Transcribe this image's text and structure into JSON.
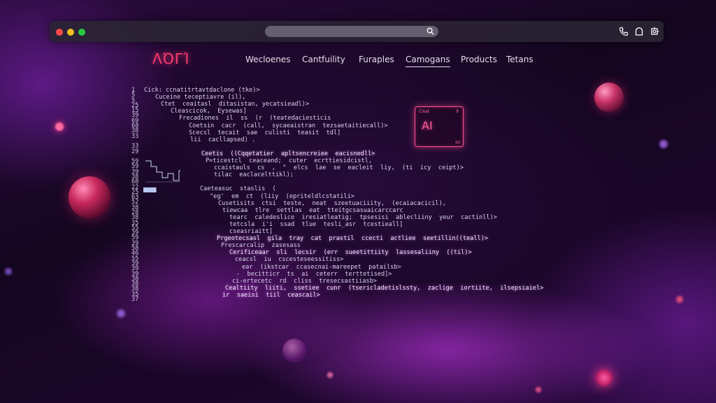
{
  "logo": "ΛΌΓΊ",
  "nav": [
    {
      "label": "Wecloenes"
    },
    {
      "label": "Cantfuility"
    },
    {
      "label": "Furaples"
    },
    {
      "label": "Camogans",
      "active": true
    },
    {
      "label": "Products"
    },
    {
      "label": "Tetans"
    }
  ],
  "ai_badge": {
    "top": "Cisat",
    "number": "9",
    "text": "AI",
    "bottom": "ez"
  },
  "mini_bars": "▆▆▆",
  "code": {
    "line_numbers": [
      "1",
      "5",
      "5",
      "25",
      "15",
      "39",
      "69",
      "68",
      "38",
      "33",
      "",
      "33",
      "29",
      "",
      "59",
      "59",
      "39",
      "38",
      "68",
      "22",
      "25",
      "63",
      "52",
      "38",
      "28",
      "38",
      "35",
      "55",
      "39",
      "59",
      "39",
      "58",
      "46",
      "55",
      "39",
      "39",
      "39",
      "38",
      "38",
      "38",
      "35",
      "37"
    ],
    "lines": [
      {
        "text": "Cick: ccnatitrtavtdaclone (tke)>",
        "indent": 18
      },
      {
        "text": "Cuceine teceptiavre (il),",
        "indent": 34
      },
      {
        "text": "Ctet  ceaitasl  ditasistan, yecatsieadl)>",
        "indent": 42
      },
      {
        "text": "Cleascicok,  Eysewas]",
        "indent": 56
      },
      {
        "text": "Frecadiones  il  ss  (r  (teatedaciesticis",
        "indent": 68
      },
      {
        "text": "Coetsin  cacr  (call,  sycaeaistran  tezsaetaitiecall)>",
        "indent": 82
      },
      {
        "text": "Scecsl  tecait  sae  culisti  teasit  tdl]",
        "indent": 82
      },
      {
        "text": "lii  cacllapsed) .",
        "indent": 84
      },
      {
        "text": "",
        "indent": 0
      },
      {
        "text": "Ceetis  ((Cqqetatier  apltsencreiee  eacisnedll>",
        "indent": 100,
        "glow": true
      },
      {
        "text": "P=ticestcl  ceaceand;  cuter  ecrttiesidcistl,",
        "indent": 106
      },
      {
        "text": "ccaistauls  cs  ,  \"  elcs  lae  se  eacleit  liy,  (ti  icy  ceipt)>",
        "indent": 118
      },
      {
        "text": "tilac  eaclacelttikl);",
        "indent": 118
      },
      {
        "text": "",
        "indent": 0
      },
      {
        "text": "Caeteasuc  staslis  (",
        "indent": 98
      },
      {
        "text": "\"eg'  em  ct  (liiy  (epriteldlcstatili>",
        "indent": 112
      },
      {
        "text": "Cusetisits  ctsi  teste,  neat  szeetuaciiity,  (ecaiacacicil),",
        "indent": 124
      },
      {
        "text": "tiewcaa  tlre  settlas  eat  tteitgcsasuaicarccarc",
        "indent": 130
      },
      {
        "text": "tearc  caledeslice  iresiatleatig;  tpsesisi  ablecliiny  yeur  cactinll)>",
        "indent": 140
      },
      {
        "text": "tetcsla  i'i  ssad  tlue  tesli_asr  tcestieall]",
        "indent": 140
      },
      {
        "text": "cseasriaitt]",
        "indent": 140
      },
      {
        "text": "Prgeotecsasl  gila  tray  cat  prastil  ccecti  actliee  seetillin((teall)>",
        "indent": 122,
        "glow": true
      },
      {
        "text": "Prescarcalip  zasesass",
        "indent": 128
      },
      {
        "text": "Cerificeaar  sli  lecsir  (err  sueetittiity  lassesaliiny  ((til)>",
        "indent": 140,
        "glow": true
      },
      {
        "text": "ceacsl  iu  cscesteseessitiss>",
        "indent": 148
      },
      {
        "text": "ear  (ikstcar  ccasecnai-mareepet  patailsb>",
        "indent": 158
      },
      {
        "text": "-  becitticr  ts  ai  ceterr  terttetised]>",
        "indent": 150
      },
      {
        "text": "ci-ertecetc  rd  cliss  tresecsastiiasb>",
        "indent": 144
      },
      {
        "text": "Cealtiity  liiti,  ssetiee  cunr  (tsericladetislssty,  zaclige  iortiite,  ilsepsiaiel>",
        "indent": 134,
        "glow": true
      },
      {
        "text": "ir  saeisi  tiil  ceascail>",
        "indent": 130,
        "glow": true
      }
    ]
  }
}
